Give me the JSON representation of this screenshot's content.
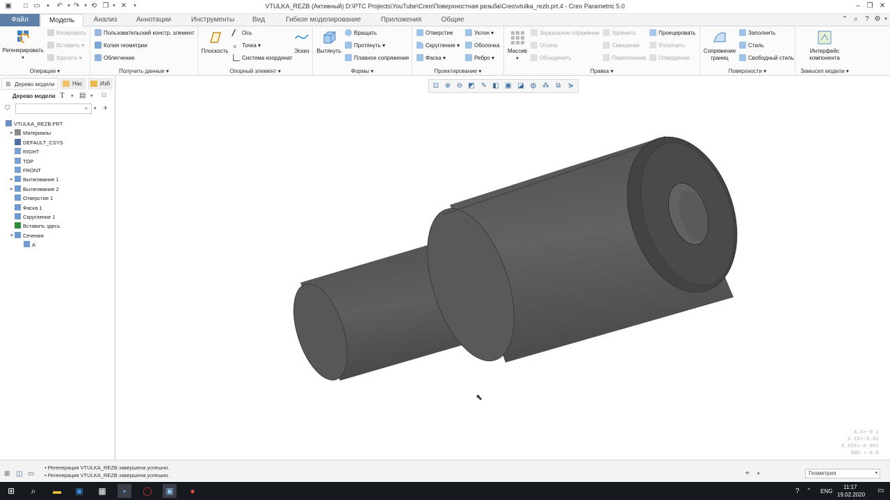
{
  "window": {
    "title": "VTULKA_REZB (Активный) D:\\PTC Projects\\YouTube\\Creo\\Поверхностная резьба\\Creo\\vtulka_rezb.prt.4 - Creo Parametric 5.0"
  },
  "tabs": [
    {
      "label": "Файл",
      "state": "file"
    },
    {
      "label": "Модель",
      "state": "active"
    },
    {
      "label": "Анализ",
      "state": ""
    },
    {
      "label": "Аннотации",
      "state": ""
    },
    {
      "label": "Инструменты",
      "state": ""
    },
    {
      "label": "Вид",
      "state": ""
    },
    {
      "label": "Гибкое моделирование",
      "state": ""
    },
    {
      "label": "Приложения",
      "state": ""
    },
    {
      "label": "Общие",
      "state": ""
    }
  ],
  "ribbon": {
    "operations": {
      "label": "Операции",
      "regenerate": "Регенерировать",
      "copy": "Копировать",
      "paste": "Вставить",
      "delete": "Удалить"
    },
    "get_data": {
      "label": "Получить данные",
      "udf": "Пользовательский констр. элемент",
      "copy_geom": "Копия геометрии",
      "shrinkwrap": "Облегчение"
    },
    "datum": {
      "label": "Опорный элемент",
      "plane": "Плоскость",
      "axis": "Ось",
      "point": "Точка",
      "csys": "Система координат",
      "sketch": "Эскиз"
    },
    "shapes": {
      "label": "Формы",
      "extrude": "Вытянуть",
      "revolve": "Вращать",
      "sweep": "Протянуть",
      "blend": "Плавное сопряжение"
    },
    "engineering": {
      "label": "Проектирование",
      "hole": "Отверстие",
      "round": "Скругление",
      "chamfer": "Фаска",
      "draft": "Уклон",
      "shell": "Оболочка",
      "rib": "Ребро"
    },
    "editing": {
      "label": "Правка",
      "pattern": "Массив",
      "mirror": "Зеркальное отражение",
      "trim": "Отсечь",
      "merge": "Объединить",
      "extend": "Удлинить",
      "offset": "Смещение",
      "intersect": "Пересечение",
      "project": "Проецировать",
      "thicken": "Уплотнить",
      "solidify": "Отвердение"
    },
    "surfaces": {
      "label": "Поверхности",
      "boundary_blend": "Сопряжение границ",
      "fill": "Заполнить",
      "style": "Стиль",
      "freestyle": "Свободный стиль"
    },
    "design_intent": {
      "label": "Замысел модели",
      "component_interface": "Интерфейс компонента"
    }
  },
  "panel": {
    "tab_model_tree": "Дерево модели",
    "tab_2": "Нас",
    "tab_3": "Изб",
    "header": "Дерево модели",
    "search_placeholder": "",
    "tree": [
      {
        "label": "VTULKA_REZB.PRT",
        "level": 0,
        "expander": "",
        "color": "#6a8fc7"
      },
      {
        "label": "Материалы",
        "level": 1,
        "expander": "▸",
        "color": "#8a8a8a"
      },
      {
        "label": "DEFAULT_CSYS",
        "level": 1,
        "expander": "",
        "color": "#4f6fa0"
      },
      {
        "label": "RIGHT",
        "level": 1,
        "expander": "",
        "color": "#7aa0d4"
      },
      {
        "label": "TOP",
        "level": 1,
        "expander": "",
        "color": "#7aa0d4"
      },
      {
        "label": "FRONT",
        "level": 1,
        "expander": "",
        "color": "#7aa0d4"
      },
      {
        "label": "Вытягивание 1",
        "level": 1,
        "expander": "▸",
        "color": "#6f9ad2"
      },
      {
        "label": "Вытягивание 2",
        "level": 1,
        "expander": "▸",
        "color": "#6f9ad2"
      },
      {
        "label": "Отверстие 1",
        "level": 1,
        "expander": "",
        "color": "#6f9ad2"
      },
      {
        "label": "Фаска 1",
        "level": 1,
        "expander": "",
        "color": "#6f9ad2"
      },
      {
        "label": "Скругление 1",
        "level": 1,
        "expander": "",
        "color": "#6f9ad2"
      },
      {
        "label": "Вставить здесь",
        "level": 1,
        "expander": "",
        "color": "#2f8a3a"
      },
      {
        "label": "Сечения",
        "level": 1,
        "expander": "▾",
        "color": "#6f9ad2"
      },
      {
        "label": "A",
        "level": 2,
        "expander": "",
        "color": "#6f9ad2"
      }
    ]
  },
  "coords": [
    "X.X+-0.1",
    "X.XX+-0.01",
    "X.XXX+-0.001",
    "ANG.+-0.5"
  ],
  "status": {
    "messages": [
      "Регенерация VTULKA_REZB завершена успешно.",
      "Регенерация VTULKA_REZB завершена успешно."
    ],
    "filter_value": "Геометрия"
  },
  "taskbar": {
    "lang": "ENG",
    "time": "11:17",
    "date": "19.02.2020"
  },
  "colors": {
    "file_tab": "#5d7fa8",
    "part": "#5a5a5c",
    "taskbar": "#16191d"
  }
}
